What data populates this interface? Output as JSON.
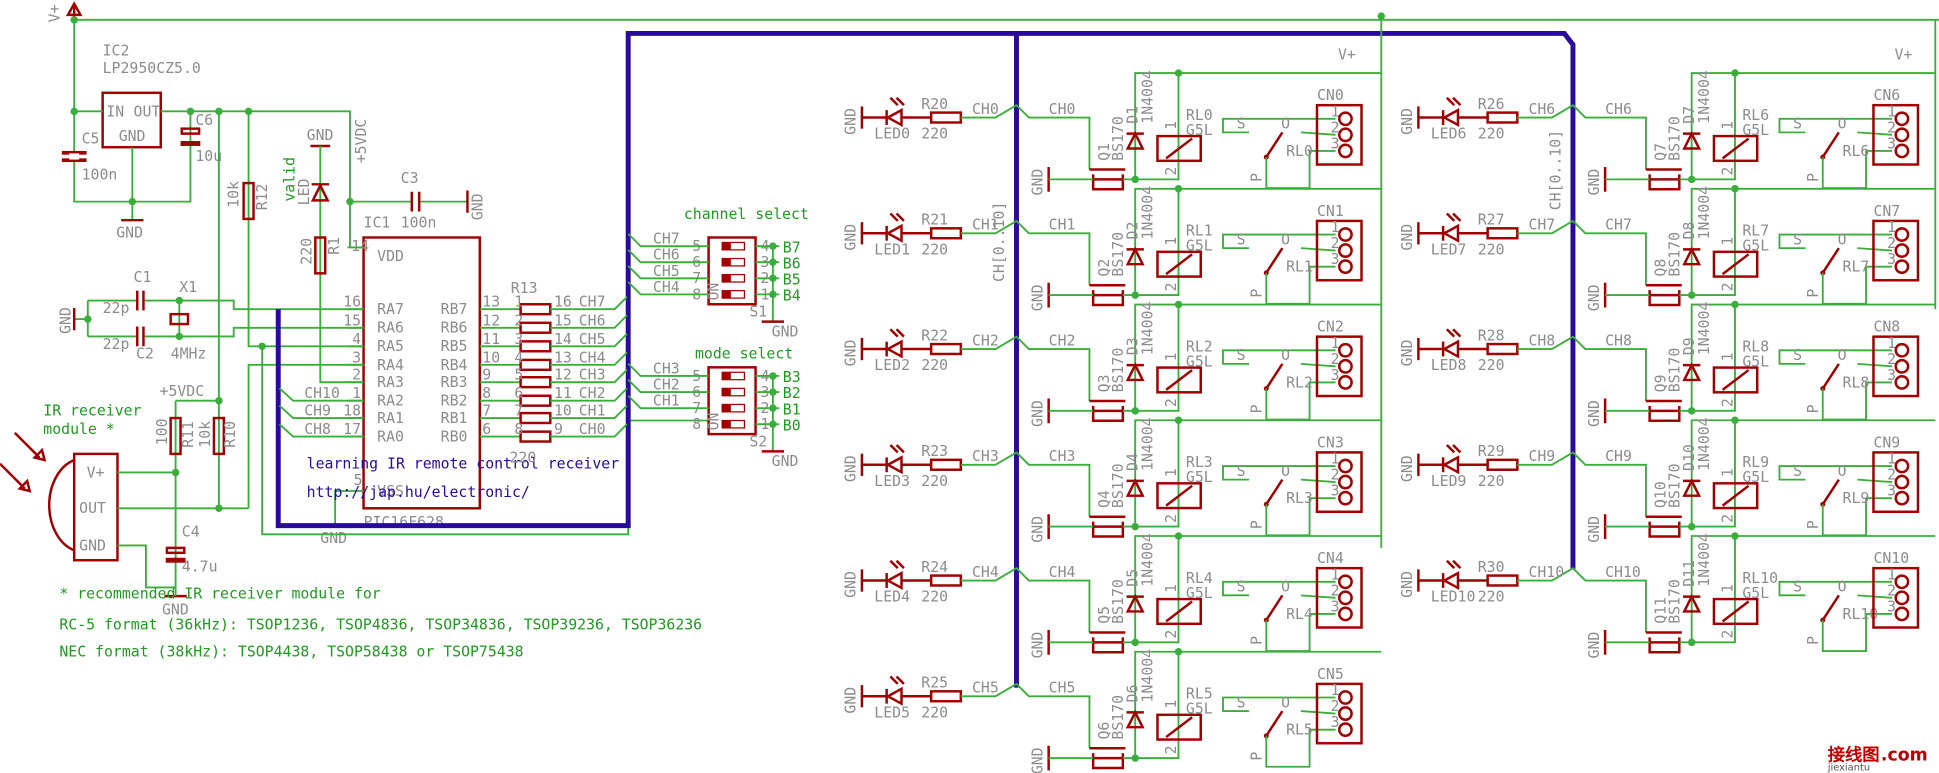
{
  "power": {
    "vplus": "V+",
    "ic2_name": "IC2",
    "ic2_value": "LP2950CZ5.0",
    "ic2_in": "IN",
    "ic2_out": "OUT",
    "ic2_gnd": "GND",
    "c5_name": "C5",
    "c5_value": "100n",
    "c6_name": "C6",
    "c6_value": "10u",
    "gnd": "GND",
    "plus5": "+5VDC"
  },
  "status_led": {
    "label": "valid",
    "led": "LED",
    "gnd": "GND",
    "r_name": "R1",
    "r_value": "220",
    "r12_name": "R12",
    "r12_value": "10k"
  },
  "mcu": {
    "name": "IC1",
    "part": "PIC16F628",
    "vdd": "VDD",
    "vdd_pin": "14",
    "vss": "VSS",
    "vss_pin": "5",
    "c3_name": "C3",
    "c3_value": "100n",
    "gnd": "GND",
    "left_pins": [
      {
        "num": "16",
        "name": "RA7"
      },
      {
        "num": "15",
        "name": "RA6"
      },
      {
        "num": "4",
        "name": "RA5"
      },
      {
        "num": "3",
        "name": "RA4"
      },
      {
        "num": "2",
        "name": "RA3"
      },
      {
        "num": "1",
        "name": "RA2"
      },
      {
        "num": "18",
        "name": "RA1"
      },
      {
        "num": "17",
        "name": "RA0"
      }
    ],
    "right_pins": [
      {
        "num": "13",
        "name": "RB7"
      },
      {
        "num": "12",
        "name": "RB6"
      },
      {
        "num": "11",
        "name": "RB5"
      },
      {
        "num": "10",
        "name": "RB4"
      },
      {
        "num": "9",
        "name": "RB3"
      },
      {
        "num": "8",
        "name": "RB2"
      },
      {
        "num": "7",
        "name": "RB1"
      },
      {
        "num": "6",
        "name": "RB0"
      }
    ],
    "left_nets": [
      "CH10",
      "CH9",
      "CH8"
    ]
  },
  "crystal": {
    "c1_name": "C1",
    "c2_name": "C2",
    "c_value": "22p",
    "x1_name": "X1",
    "x1_value": "4MHz",
    "gnd": "GND"
  },
  "resistor_array": {
    "name": "R13",
    "value": "220",
    "left_nums": [
      "1",
      "2",
      "3",
      "4",
      "5",
      "6",
      "7",
      "8"
    ],
    "right_nums": [
      "16",
      "15",
      "14",
      "13",
      "12",
      "11",
      "10",
      "9"
    ],
    "nets": [
      "CH7",
      "CH6",
      "CH5",
      "CH4",
      "CH3",
      "CH2",
      "CH1",
      "CH0"
    ]
  },
  "ir_receiver": {
    "title_line1": "IR receiver",
    "title_line2": "module *",
    "pin_vplus": "V+",
    "pin_out": "OUT",
    "pin_gnd": "GND",
    "plus5": "+5VDC",
    "r11_name": "R11",
    "r11_value": "100",
    "r10_name": "R10",
    "r10_value": "10k",
    "c4_name": "C4",
    "c4_value": "4.7u",
    "gnd": "GND"
  },
  "channel_select": {
    "title": "channel select",
    "name": "S1",
    "left_pins": [
      "5",
      "6",
      "7",
      "8"
    ],
    "right_pins": [
      "4",
      "3",
      "2",
      "1"
    ],
    "outputs": [
      "B7",
      "B6",
      "B5",
      "B4"
    ],
    "nets": [
      "CH7",
      "CH6",
      "CH5",
      "CH4"
    ],
    "on": "ON",
    "gnd": "GND"
  },
  "mode_select": {
    "title": "mode select",
    "name": "S2",
    "left_pins": [
      "5",
      "6",
      "7",
      "8"
    ],
    "right_pins": [
      "4",
      "3",
      "2",
      "1"
    ],
    "outputs": [
      "B3",
      "B2",
      "B1",
      "B0"
    ],
    "nets": [
      "CH3",
      "CH2",
      "CH1"
    ],
    "on": "ON",
    "gnd": "GND"
  },
  "caption": {
    "line1": "learning IR remote control receiver",
    "line2": "http://jap.hu/electronic/"
  },
  "notes": {
    "line1": "* recommended IR receiver module for",
    "line2": "RC-5 format (36kHz): TSOP1236, TSOP4836, TSOP34836, TSOP39236, TSOP36236",
    "line3": "NEC format (38kHz): TSOP4438, TSOP58438 or TSOP75438"
  },
  "bus_label": "CH[0..10]",
  "relay_vplus": "V+",
  "channels": [
    {
      "led": "LED0",
      "r": "R20",
      "r_val": "220",
      "ch": "CH0",
      "q": "Q1",
      "q_val": "BS170",
      "d": "D1",
      "d_val": "1N4004",
      "rl": "RL0",
      "rl_val": "G5L",
      "cn": "CN0"
    },
    {
      "led": "LED1",
      "r": "R21",
      "r_val": "220",
      "ch": "CH1",
      "q": "Q2",
      "q_val": "BS170",
      "d": "D2",
      "d_val": "1N4004",
      "rl": "RL1",
      "rl_val": "G5L",
      "cn": "CN1"
    },
    {
      "led": "LED2",
      "r": "R22",
      "r_val": "220",
      "ch": "CH2",
      "q": "Q3",
      "q_val": "BS170",
      "d": "D3",
      "d_val": "1N4004",
      "rl": "RL2",
      "rl_val": "G5L",
      "cn": "CN2"
    },
    {
      "led": "LED3",
      "r": "R23",
      "r_val": "220",
      "ch": "CH3",
      "q": "Q4",
      "q_val": "BS170",
      "d": "D4",
      "d_val": "1N4004",
      "rl": "RL3",
      "rl_val": "G5L",
      "cn": "CN3"
    },
    {
      "led": "LED4",
      "r": "R24",
      "r_val": "220",
      "ch": "CH4",
      "q": "Q5",
      "q_val": "BS170",
      "d": "D5",
      "d_val": "1N4004",
      "rl": "RL4",
      "rl_val": "G5L",
      "cn": "CN4"
    },
    {
      "led": "LED5",
      "r": "R25",
      "r_val": "220",
      "ch": "CH5",
      "q": "Q6",
      "q_val": "BS170",
      "d": "D6",
      "d_val": "1N4004",
      "rl": "RL5",
      "rl_val": "G5L",
      "cn": "CN5"
    },
    {
      "led": "LED6",
      "r": "R26",
      "r_val": "220",
      "ch": "CH6",
      "q": "Q7",
      "q_val": "BS170",
      "d": "D7",
      "d_val": "1N4004",
      "rl": "RL6",
      "rl_val": "G5L",
      "cn": "CN6"
    },
    {
      "led": "LED7",
      "r": "R27",
      "r_val": "220",
      "ch": "CH7",
      "q": "Q8",
      "q_val": "BS170",
      "d": "D8",
      "d_val": "1N4004",
      "rl": "RL7",
      "rl_val": "G5L",
      "cn": "CN7"
    },
    {
      "led": "LED8",
      "r": "R28",
      "r_val": "220",
      "ch": "CH8",
      "q": "Q9",
      "q_val": "BS170",
      "d": "D9",
      "d_val": "1N4004",
      "rl": "RL8",
      "rl_val": "G5L",
      "cn": "CN8"
    },
    {
      "led": "LED9",
      "r": "R29",
      "r_val": "220",
      "ch": "CH9",
      "q": "Q10",
      "q_val": "BS170",
      "d": "D10",
      "d_val": "1N4004",
      "rl": "RL9",
      "rl_val": "G5L",
      "cn": "CN9"
    },
    {
      "led": "LED10",
      "r": "R30",
      "r_val": "220",
      "ch": "CH10",
      "q": "Q11",
      "q_val": "BS170",
      "d": "D11",
      "d_val": "1N4004",
      "rl": "RL10",
      "rl_val": "G5L",
      "cn": "CN10"
    }
  ],
  "channel_common": {
    "gnd": "GND",
    "coil_pins": [
      "1",
      "2"
    ],
    "cn_pins": [
      "1",
      "2",
      "3"
    ],
    "s": "S",
    "o": "O",
    "p": "P"
  },
  "watermark": {
    "text": "接线图",
    "suffix": ".com",
    "sub": "jiexiantu"
  },
  "colors": {
    "component": "#a00000",
    "wire": "#3aae3a",
    "bus": "#2a0a9c",
    "text": "#8c8c8c",
    "note": "#1f9a1f"
  }
}
